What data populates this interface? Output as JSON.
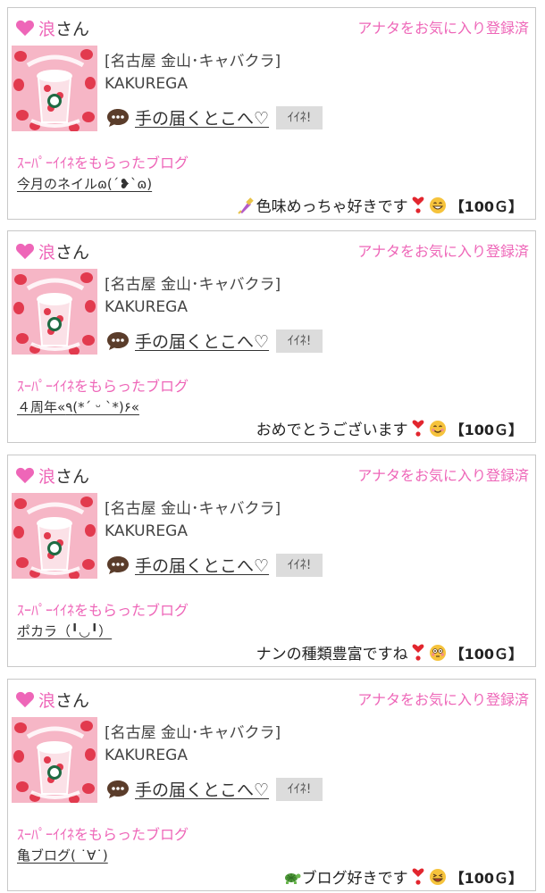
{
  "colors": {
    "accent_pink": "#ee66b8",
    "border": "#c8c8c8",
    "button_bg": "#dcdcdc"
  },
  "cards": [
    {
      "user_name": "浪",
      "user_suffix": "さん",
      "fav_label": "アナタをお気に入り登録済",
      "shop_category": "[名古屋 金山･キャバクラ]",
      "shop_name": "KAKUREGA",
      "blog_title": "手の届くとこへ♡",
      "ine_label": "ｲｲﾈ!",
      "super_label": "ｽｰﾊﾟｰｲｲﾈをもらったブログ",
      "post_title": "今月のネイルɷ(´❥`ɷ)",
      "comment_icon": "nail-polish-icon",
      "comment_text": "色味めっちゃ好きです",
      "heart_icon": "red-heart-exclamation-icon",
      "face_icon": "grinning-face-icon",
      "points": "【100Ｇ】"
    },
    {
      "user_name": "浪",
      "user_suffix": "さん",
      "fav_label": "アナタをお気に入り登録済",
      "shop_category": "[名古屋 金山･キャバクラ]",
      "shop_name": "KAKUREGA",
      "blog_title": "手の届くとこへ♡",
      "ine_label": "ｲｲﾈ!",
      "super_label": "ｽｰﾊﾟｰｲｲﾈをもらったブログ",
      "post_title": "４周年«٩(*´ ᵕ `*)۶«",
      "comment_icon": "",
      "comment_text": "おめでとうございます",
      "heart_icon": "red-heart-exclamation-icon",
      "face_icon": "smiling-face-icon",
      "points": "【100Ｇ】"
    },
    {
      "user_name": "浪",
      "user_suffix": "さん",
      "fav_label": "アナタをお気に入り登録済",
      "shop_category": "[名古屋 金山･キャバクラ]",
      "shop_name": "KAKUREGA",
      "blog_title": "手の届くとこへ♡",
      "ine_label": "ｲｲﾈ!",
      "super_label": "ｽｰﾊﾟｰｲｲﾈをもらったブログ",
      "post_title": "ポカラ（╹◡╹）",
      "comment_icon": "",
      "comment_text": "ナンの種類豊富ですね",
      "heart_icon": "red-heart-exclamation-icon",
      "face_icon": "flushed-face-icon",
      "points": "【100Ｇ】"
    },
    {
      "user_name": "浪",
      "user_suffix": "さん",
      "fav_label": "アナタをお気に入り登録済",
      "shop_category": "[名古屋 金山･キャバクラ]",
      "shop_name": "KAKUREGA",
      "blog_title": "手の届くとこへ♡",
      "ine_label": "ｲｲﾈ!",
      "super_label": "ｽｰﾊﾟｰｲｲﾈをもらったブログ",
      "post_title": "亀ブログ( ˙∀˙)",
      "comment_icon": "turtle-icon",
      "comment_text": "ブログ好きです",
      "heart_icon": "red-heart-exclamation-icon",
      "face_icon": "laughing-face-icon",
      "points": "【100Ｇ】"
    }
  ]
}
